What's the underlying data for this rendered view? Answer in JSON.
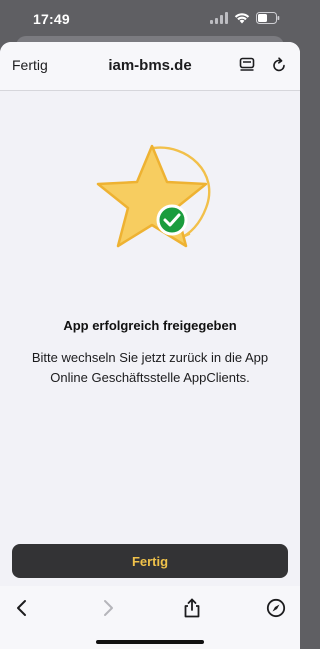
{
  "status_bar": {
    "time": "17:49"
  },
  "header": {
    "done_label": "Fertig",
    "title": "iam-bms.de"
  },
  "content": {
    "title": "App erfolgreich freigegeben",
    "message": "Bitte wechseln Sie jetzt zurück in die App Online Geschäftsstelle AppClients."
  },
  "action": {
    "done_label": "Fertig"
  },
  "colors": {
    "accent": "#f0c24a",
    "button_bg": "#333335",
    "check_green": "#1a9c3e",
    "star_fill": "#f7cd60"
  },
  "icons": {
    "header_reader": "reader-icon",
    "header_reload": "reload-icon",
    "illustration": "star-check-icon",
    "toolbar": [
      "back-icon",
      "forward-icon",
      "share-icon",
      "compass-icon"
    ]
  }
}
